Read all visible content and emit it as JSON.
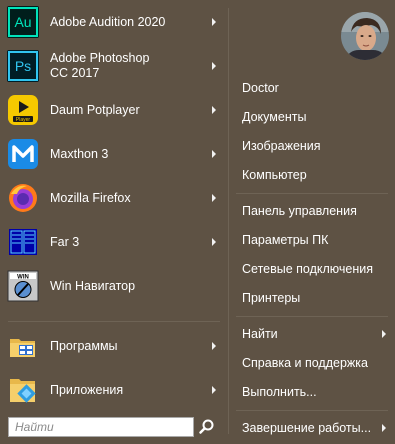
{
  "left_menu": {
    "items": [
      {
        "label": "Adobe Audition 2020",
        "icon": "adobe-audition-icon",
        "arrow": true
      },
      {
        "label": "Adobe Photoshop CC 2017",
        "icon": "adobe-photoshop-icon",
        "arrow": true
      },
      {
        "label": "Daum Potplayer",
        "icon": "potplayer-icon",
        "arrow": true
      },
      {
        "label": "Maxthon 3",
        "icon": "maxthon-icon",
        "arrow": true
      },
      {
        "label": "Mozilla Firefox",
        "icon": "firefox-icon",
        "arrow": true
      },
      {
        "label": "Far 3",
        "icon": "far-manager-icon",
        "arrow": true
      },
      {
        "label": "Win Навигатор",
        "icon": "win-navigator-icon",
        "arrow": false
      }
    ],
    "programs": {
      "label": "Программы",
      "icon": "programs-folder-icon"
    },
    "apps": {
      "label": "Приложения",
      "icon": "apps-folder-icon"
    }
  },
  "search": {
    "placeholder": "Найти",
    "icon": "search-icon"
  },
  "right_menu": {
    "user": "Doctor",
    "documents": "Документы",
    "pictures": "Изображения",
    "computer": "Компьютер",
    "control_panel": "Панель управления",
    "pc_settings": "Параметры ПК",
    "network": "Сетевые подключения",
    "printers": "Принтеры",
    "find": "Найти",
    "help": "Справка и поддержка",
    "run": "Выполнить...",
    "shutdown": "Завершение работы..."
  },
  "colors": {
    "background": "#5e5244",
    "text": "#ffffff",
    "separator": "#6e6355"
  }
}
